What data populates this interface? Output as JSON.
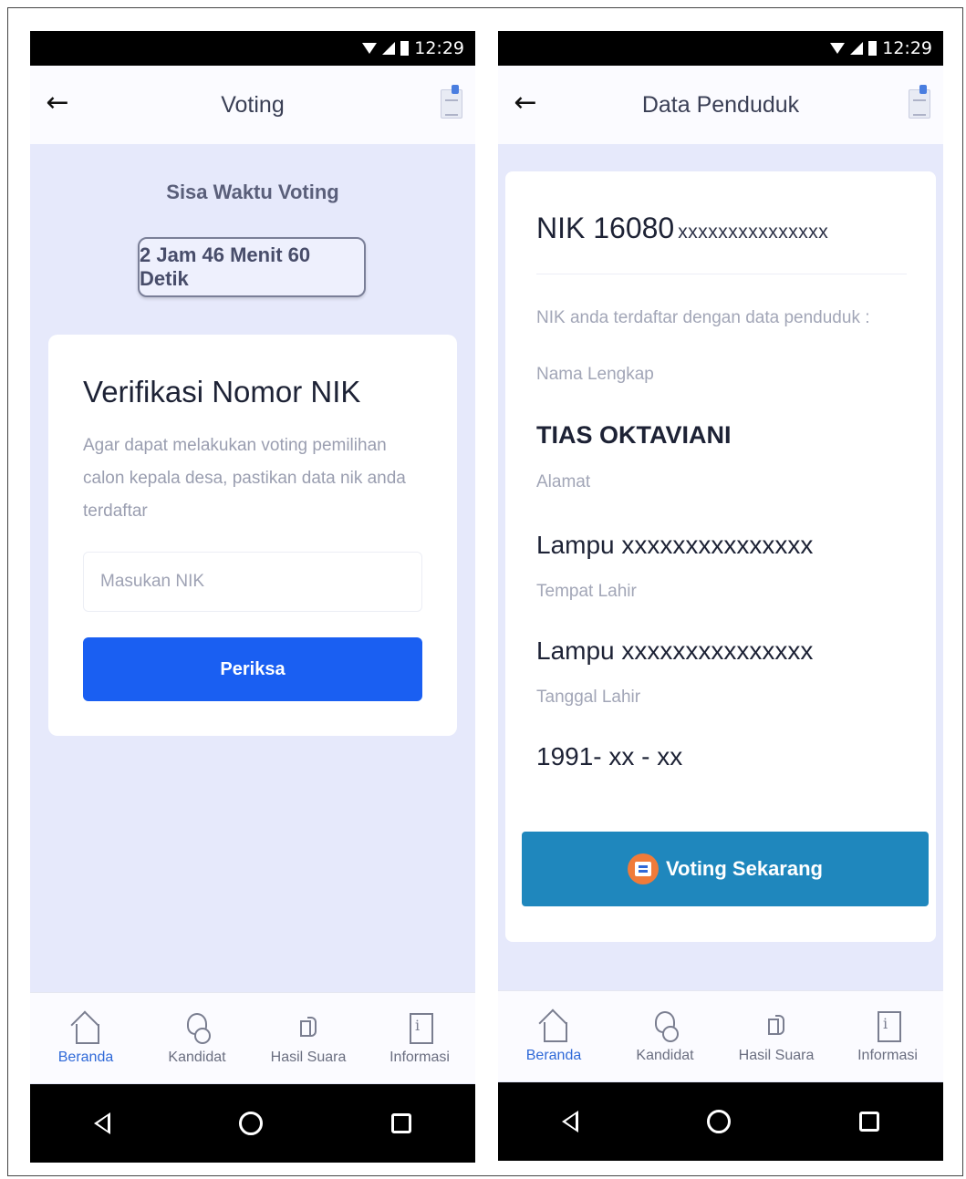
{
  "status": {
    "time": "12:29"
  },
  "left": {
    "appbar_title": "Voting",
    "timer_label": "Sisa Waktu Voting",
    "timer_value": "2 Jam 46 Menit 60 Detik",
    "card_title": "Verifikasi Nomor NIK",
    "card_desc": "Agar dapat melakukan voting pemilihan calon kepala desa, pastikan data nik anda terdaftar",
    "nik_placeholder": "Masukan NIK",
    "check_button": "Periksa"
  },
  "right": {
    "appbar_title": "Data Penduduk",
    "nik_prefix": "NIK 16080",
    "nik_masked": "xxxxxxxxxxxxxxx",
    "registered_note": "NIK anda terdaftar dengan data penduduk :",
    "fields": [
      {
        "label": "Nama Lengkap",
        "value": "TIAS OKTAVIANI"
      },
      {
        "label": "Alamat",
        "value": "Lampu xxxxxxxxxxxxxxx"
      },
      {
        "label": "Tempat Lahir",
        "value": "Lampu xxxxxxxxxxxxxxx"
      },
      {
        "label": "Tanggal Lahir",
        "value": "1991- xx - xx"
      }
    ],
    "vote_button": "Voting Sekarang"
  },
  "bottom_nav": [
    {
      "label": "Beranda",
      "icon": "home-icon",
      "active": true
    },
    {
      "label": "Kandidat",
      "icon": "candidate-icon",
      "active": false
    },
    {
      "label": "Hasil Suara",
      "icon": "megaphone-icon",
      "active": false
    },
    {
      "label": "Informasi",
      "icon": "info-document-icon",
      "active": false
    }
  ],
  "colors": {
    "primary_button": "#1a5ff2",
    "vote_button": "#1f87bd",
    "active_nav": "#2f69d8",
    "screen_bg": "#e6e9fb"
  }
}
